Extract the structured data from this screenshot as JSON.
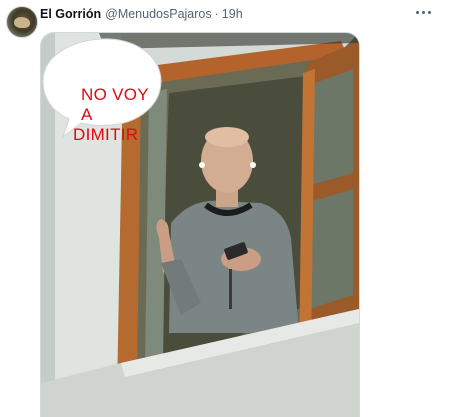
{
  "tweet": {
    "author_name": "El Gorrión",
    "author_handle": "@MenudosPajaros",
    "separator": "·",
    "time": "19h",
    "avatar_icon": "sparrow-avatar",
    "more_icon": "more-horizontal-icon"
  },
  "media": {
    "speech_bubble_lines": [
      "NO VOY",
      "A",
      "DIMITIR"
    ],
    "bubble_text_color": "#e00a12"
  },
  "colors": {
    "name": "#0f1419",
    "secondary_text": "#536471",
    "border": "#cfd9de"
  }
}
